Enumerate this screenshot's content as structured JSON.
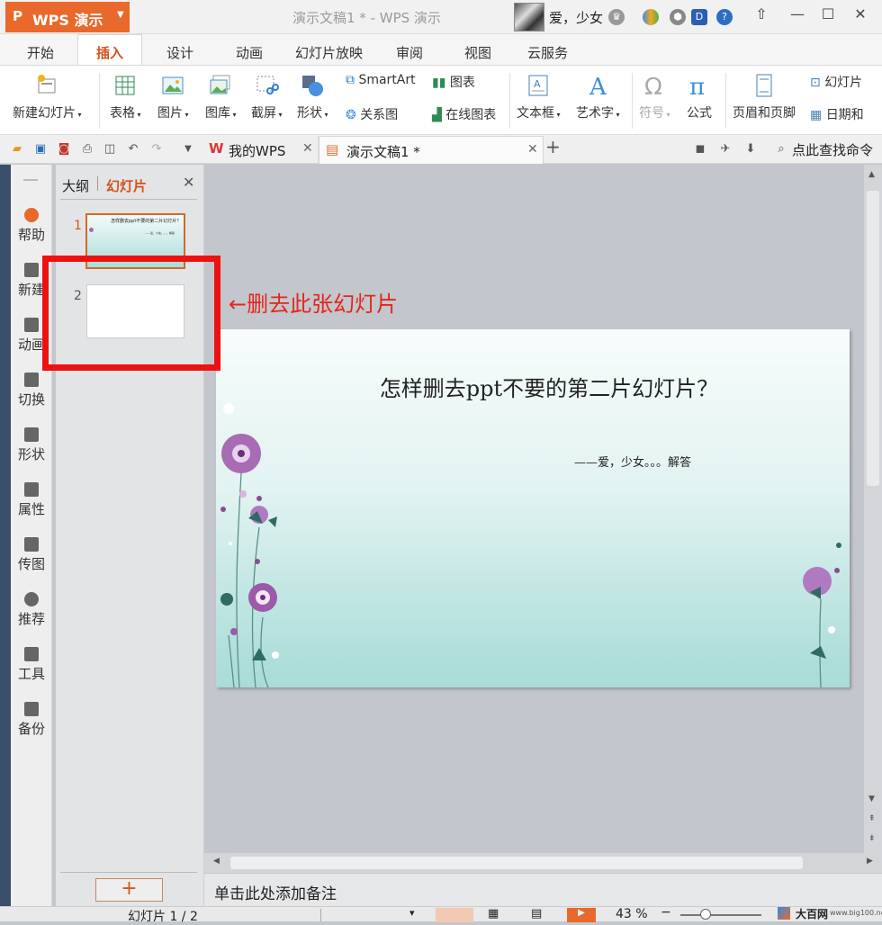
{
  "app": {
    "name": "WPS 演示",
    "doc_title": "演示文稿1 * - WPS 演示",
    "user": "爱，少女"
  },
  "ribbon_tabs": [
    "开始",
    "插入",
    "设计",
    "动画",
    "幻灯片放映",
    "审阅",
    "视图",
    "云服务"
  ],
  "ribbon": {
    "new_slide": "新建幻灯片",
    "table": "表格",
    "picture": "图片",
    "gallery": "图库",
    "screenshot": "截屏",
    "shape": "形状",
    "smartart": "SmartArt",
    "chart": "图表",
    "relation": "关系图",
    "online_chart": "在线图表",
    "textbox": "文本框",
    "wordart": "艺术字",
    "symbol": "符号",
    "formula": "公式",
    "header_footer": "页眉和页脚",
    "slide_num": "幻灯片",
    "date": "日期和"
  },
  "doc_tabs": {
    "mywps": "我的WPS",
    "current": "演示文稿1 *"
  },
  "search_placeholder": "点此查找命令",
  "left_sidebar": [
    "帮助",
    "新建",
    "动画",
    "切换",
    "形状",
    "属性",
    "传图",
    "推荐",
    "工具",
    "备份"
  ],
  "panel": {
    "tab_outline": "大纲",
    "tab_slides": "幻灯片",
    "slide1_num": "1",
    "slide2_num": "2",
    "thumb_title": "怎样删去ppt不要的第二片幻灯片？",
    "thumb_sub": "——爱，少女。。。解答",
    "add": "+"
  },
  "annotation": "←删去此张幻灯片",
  "slide": {
    "title": "怎样删去ppt不要的第二片幻灯片？",
    "subtitle": "——爱，少女。。。解答"
  },
  "notes_placeholder": "单击此处添加备注",
  "status": {
    "slide_count": "幻灯片 1 / 2",
    "zoom": "43 %"
  },
  "watermark": {
    "name": "大百网",
    "url": "www.big100.net"
  },
  "colors": {
    "accent": "#e9692c",
    "annotation": "#ee1111"
  }
}
